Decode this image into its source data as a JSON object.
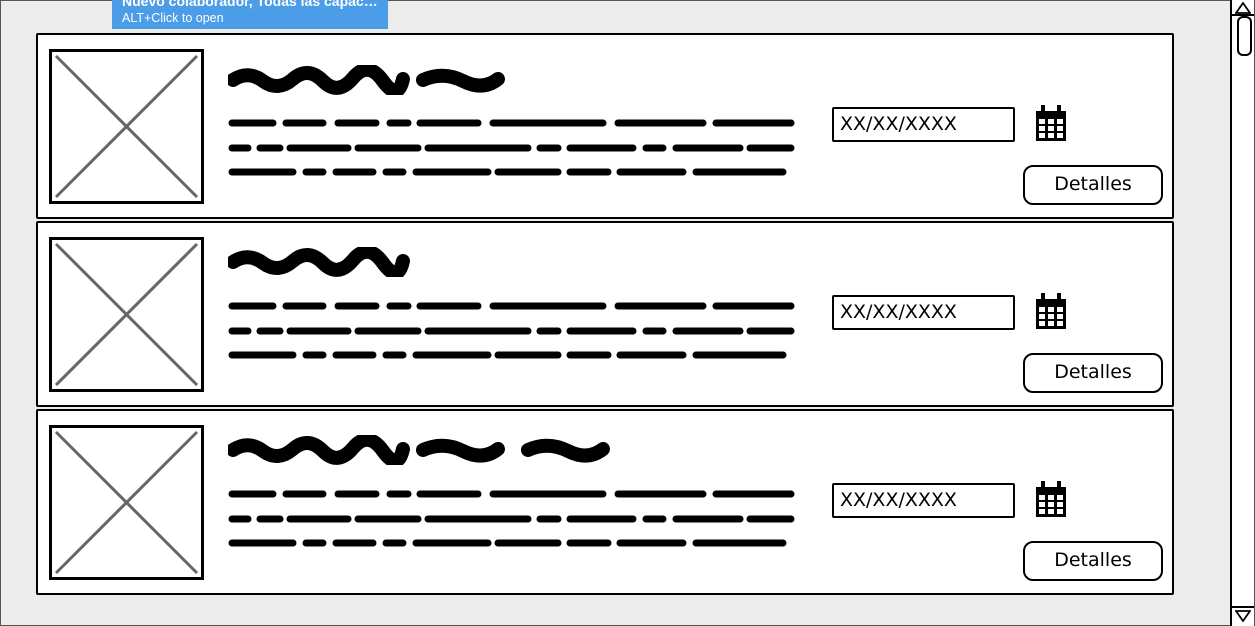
{
  "tooltip": {
    "title": "Nuevo colaborador, Todas las capacit...",
    "hint": "ALT+Click to open"
  },
  "cards": [
    {
      "date_placeholder": "XX/XX/XXXX",
      "details_label": "Detalles"
    },
    {
      "date_placeholder": "XX/XX/XXXX",
      "details_label": "Detalles"
    },
    {
      "date_placeholder": "XX/XX/XXXX",
      "details_label": "Detalles"
    }
  ],
  "icons": {
    "image": "image-placeholder-icon",
    "calendar": "calendar-icon",
    "scroll_up": "scroll-up-arrow-icon",
    "scroll_down": "scroll-down-arrow-icon"
  }
}
